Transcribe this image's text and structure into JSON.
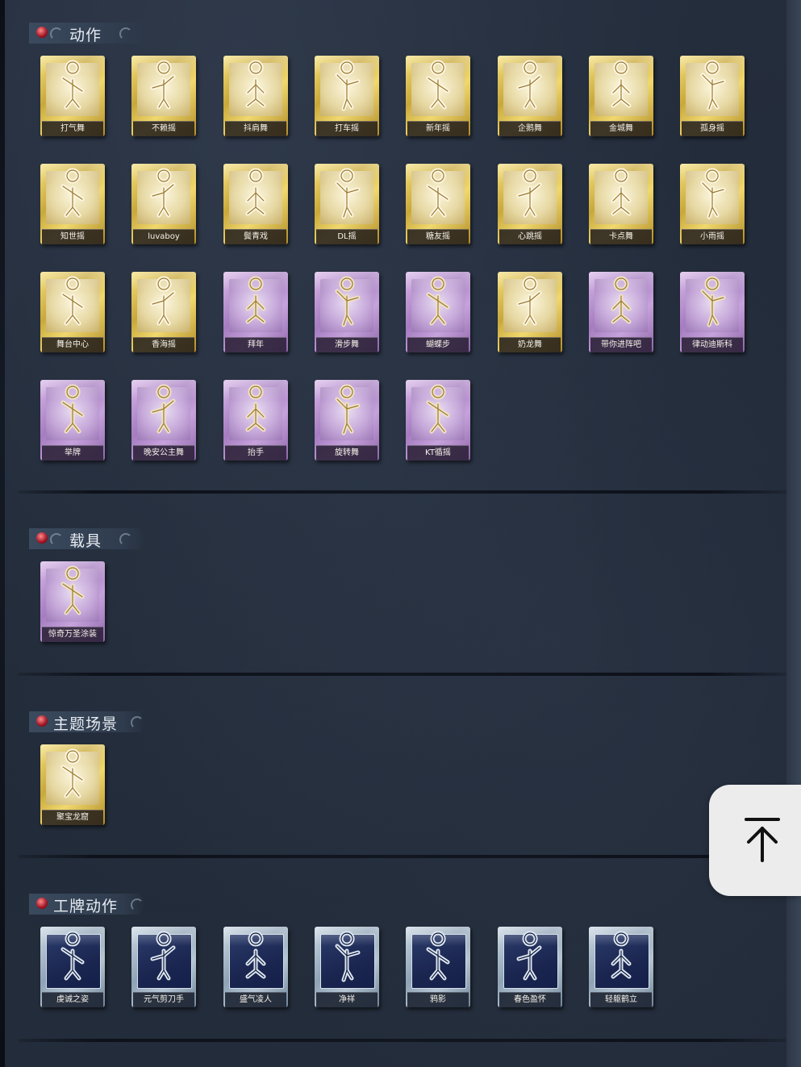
{
  "sections": [
    {
      "id": "actions",
      "title": "动作",
      "items": [
        {
          "label": "打气舞",
          "tier": "gold"
        },
        {
          "label": "不赖摇",
          "tier": "gold"
        },
        {
          "label": "抖肩舞",
          "tier": "gold"
        },
        {
          "label": "打车摇",
          "tier": "gold"
        },
        {
          "label": "新年摇",
          "tier": "gold"
        },
        {
          "label": "企鹅舞",
          "tier": "gold"
        },
        {
          "label": "金城舞",
          "tier": "gold"
        },
        {
          "label": "孤身摇",
          "tier": "gold"
        },
        {
          "label": "知世摇",
          "tier": "gold"
        },
        {
          "label": "luvaboy",
          "tier": "gold"
        },
        {
          "label": "鬓青戏",
          "tier": "gold"
        },
        {
          "label": "DL摇",
          "tier": "gold"
        },
        {
          "label": "糖友摇",
          "tier": "gold"
        },
        {
          "label": "心跳摇",
          "tier": "gold"
        },
        {
          "label": "卡点舞",
          "tier": "gold"
        },
        {
          "label": "小雨摇",
          "tier": "gold"
        },
        {
          "label": "舞台中心",
          "tier": "gold"
        },
        {
          "label": "香海摇",
          "tier": "gold"
        },
        {
          "label": "拜年",
          "tier": "purple"
        },
        {
          "label": "滑步舞",
          "tier": "purple"
        },
        {
          "label": "蝴蝶步",
          "tier": "purple"
        },
        {
          "label": "奶龙舞",
          "tier": "gold"
        },
        {
          "label": "带你进阵吧",
          "tier": "purple"
        },
        {
          "label": "律动迪斯科",
          "tier": "purple"
        },
        {
          "label": "举牌",
          "tier": "purple"
        },
        {
          "label": "晚安公主舞",
          "tier": "purple"
        },
        {
          "label": "抬手",
          "tier": "purple"
        },
        {
          "label": "旋转舞",
          "tier": "purple"
        },
        {
          "label": "KT循摇",
          "tier": "purple"
        }
      ]
    },
    {
      "id": "vehicles",
      "title": "载具",
      "items": [
        {
          "label": "惊奇万圣涂装",
          "tier": "purple"
        }
      ]
    },
    {
      "id": "theme-scene",
      "title": "主题场景",
      "items": [
        {
          "label": "聚宝龙窟",
          "tier": "gold"
        }
      ]
    },
    {
      "id": "badge-actions",
      "title": "工牌动作",
      "items": [
        {
          "label": "虔诚之姿",
          "tier": "steel"
        },
        {
          "label": "元气剪刀手",
          "tier": "steel"
        },
        {
          "label": "盛气凌人",
          "tier": "steel"
        },
        {
          "label": "净祥",
          "tier": "steel"
        },
        {
          "label": "鸦影",
          "tier": "steel"
        },
        {
          "label": "春色盈怀",
          "tier": "steel"
        },
        {
          "label": "轻躯鹤立",
          "tier": "steel"
        }
      ]
    }
  ],
  "scroll_top_button": {
    "icon": "arrow-up-to-top-icon"
  },
  "colors": {
    "gold_card": "#d9bc4c",
    "purple_card": "#b58ccc",
    "steel_card": "#9fb2c4",
    "background": "#222b39"
  }
}
